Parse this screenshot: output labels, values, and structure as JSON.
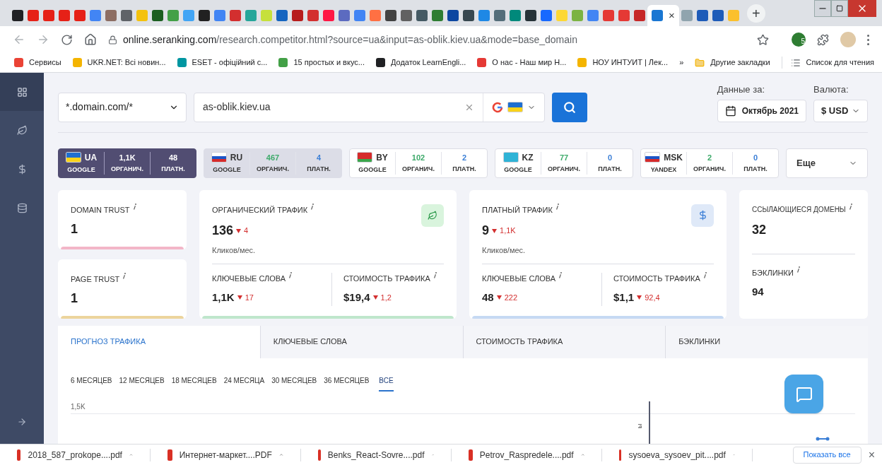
{
  "browser": {
    "tabs": [
      {
        "color": "#202124",
        "selected": false
      },
      {
        "color": "#e62117",
        "selected": false
      },
      {
        "color": "#e62117",
        "selected": false
      },
      {
        "color": "#e62117",
        "selected": false
      },
      {
        "color": "#e62117",
        "selected": false
      },
      {
        "color": "#4285f4",
        "selected": false
      },
      {
        "color": "#8d6e63",
        "selected": false
      },
      {
        "color": "#5f6368",
        "selected": false
      },
      {
        "color": "#f4c20d",
        "selected": false
      },
      {
        "color": "#1b5e20",
        "selected": false
      },
      {
        "color": "#43a047",
        "selected": false
      },
      {
        "color": "#42a5f5",
        "selected": false
      },
      {
        "color": "#212121",
        "selected": false
      },
      {
        "color": "#4285f4",
        "selected": false
      },
      {
        "color": "#d32f2f",
        "selected": false
      },
      {
        "color": "#26a69a",
        "selected": false
      },
      {
        "color": "#c6e03b",
        "selected": false
      },
      {
        "color": "#1565c0",
        "selected": false
      },
      {
        "color": "#b71c1c",
        "selected": false
      },
      {
        "color": "#d32f2f",
        "selected": false
      },
      {
        "color": "#ff1744",
        "selected": false
      },
      {
        "color": "#5c6bc0",
        "selected": false
      },
      {
        "color": "#4285f4",
        "selected": false
      },
      {
        "color": "#ff7043",
        "selected": false
      },
      {
        "color": "#424242",
        "selected": false
      },
      {
        "color": "#616161",
        "selected": false
      },
      {
        "color": "#455a64",
        "selected": false
      },
      {
        "color": "#2e7d32",
        "selected": false
      },
      {
        "color": "#0d47a1",
        "selected": false
      },
      {
        "color": "#37474f",
        "selected": false
      },
      {
        "color": "#1e88e5",
        "selected": false
      },
      {
        "color": "#546e7a",
        "selected": false
      },
      {
        "color": "#00897b",
        "selected": false
      },
      {
        "color": "#263238",
        "selected": false
      },
      {
        "color": "#1769ff",
        "selected": false
      },
      {
        "color": "#fdd835",
        "selected": false
      },
      {
        "color": "#7cb342",
        "selected": false
      },
      {
        "color": "#4285f4",
        "selected": false
      },
      {
        "color": "#e53935",
        "selected": false
      },
      {
        "color": "#e53935",
        "selected": false
      },
      {
        "color": "#c62828",
        "selected": false
      },
      {
        "color": "#1976d2",
        "selected": true
      },
      {
        "color": "#90a4ae",
        "selected": false
      },
      {
        "color": "#1e5bb8",
        "selected": false
      },
      {
        "color": "#1e5bb8",
        "selected": false
      },
      {
        "color": "#fbc02d",
        "selected": false
      }
    ],
    "tab_close": "×",
    "new_tab": "+",
    "url_host": "online.seranking.com",
    "url_path": "/research.competitor.html?source=ua&input=as-oblik.kiev.ua&mode=base_domain",
    "extension_badge": "5",
    "bookmarks": [
      {
        "label": "Сервисы",
        "color": "#ea4335"
      },
      {
        "label": "UKR.NET: Всі новин...",
        "color": "#f4b400"
      },
      {
        "label": "ESET - офіційний с...",
        "color": "#0096a1"
      },
      {
        "label": "15 простых и вкус...",
        "color": "#43a047"
      },
      {
        "label": "Додаток LearnEngli...",
        "color": "#202124"
      },
      {
        "label": "О нас - Наш мир Н...",
        "color": "#e53935"
      },
      {
        "label": "НОУ ИНТУИТ | Лек...",
        "color": "#f4b400"
      }
    ],
    "bookmarks_more": "»",
    "other_bookmarks": "Другие закладки",
    "reading_list": "Список для чтения"
  },
  "search": {
    "mode": "*.domain.com/*",
    "query": "as-oblik.kiev.ua",
    "date_label": "Данные за:",
    "date": "Октябрь 2021",
    "currency_label": "Валюта:",
    "currency": "$ USD"
  },
  "regions": [
    {
      "kind": "ua",
      "code": "UA",
      "engine": "GOOGLE",
      "organic": "1,1K",
      "organic_label": "ОРГАНИЧ.",
      "paid": "48",
      "paid_label": "ПЛАТН.",
      "selected": true,
      "hovered": false
    },
    {
      "kind": "ru",
      "code": "RU",
      "engine": "GOOGLE",
      "organic": "467",
      "organic_label": "ОРГАНИЧ.",
      "paid": "4",
      "paid_label": "ПЛАТН.",
      "selected": false,
      "hovered": true
    },
    {
      "kind": "by",
      "code": "BY",
      "engine": "GOOGLE",
      "organic": "102",
      "organic_label": "ОРГАНИЧ.",
      "paid": "2",
      "paid_label": "ПЛАТН.",
      "selected": false,
      "hovered": false
    },
    {
      "kind": "kz",
      "code": "KZ",
      "engine": "GOOGLE",
      "organic": "77",
      "organic_label": "ОРГАНИЧ.",
      "paid": "0",
      "paid_label": "ПЛАТН.",
      "selected": false,
      "hovered": false
    },
    {
      "kind": "ru",
      "code": "MSK",
      "engine": "YANDEX",
      "organic": "2",
      "organic_label": "ОРГАНИЧ.",
      "paid": "0",
      "paid_label": "ПЛАТН.",
      "selected": false,
      "hovered": false
    }
  ],
  "regions_more": "Еще",
  "trust": [
    {
      "label": "DOMAIN TRUST",
      "value": "1",
      "color": "#f3b6c8"
    },
    {
      "label": "PAGE TRUST",
      "value": "1",
      "color": "#ecd49c"
    }
  ],
  "traffic_cards": [
    {
      "kind": "organic",
      "title": "ОРГАНИЧЕСКИЙ ТРАФИК",
      "value": "136",
      "delta": "4",
      "unit": "Кликов/мес.",
      "keywords_label": "КЛЮЧЕВЫЕ СЛОВА",
      "keywords": "1,1K",
      "keywords_delta": "17",
      "cost_label": "СТОИМОСТЬ ТРАФИКА",
      "cost": "$19,4",
      "cost_delta": "1,2",
      "color": "#bfe6cc"
    },
    {
      "kind": "paid",
      "title": "ПЛАТНЫЙ ТРАФИК",
      "value": "9",
      "delta": "1,1K",
      "unit": "Кликов/мес.",
      "keywords_label": "КЛЮЧЕВЫЕ СЛОВА",
      "keywords": "48",
      "keywords_delta": "222",
      "cost_label": "СТОИМОСТЬ ТРАФИКА",
      "cost": "$1,1",
      "cost_delta": "92,4",
      "color": "#c6d9f3"
    }
  ],
  "links": {
    "domains_label": "ССЫЛАЮЩИЕСЯ ДОМЕНЫ",
    "domains": "32",
    "backlinks_label": "БЭКЛИНКИ",
    "backlinks": "94"
  },
  "chart_tabs": [
    {
      "label": "ПРОГНОЗ ТРАФИКА",
      "selected": true
    },
    {
      "label": "КЛЮЧЕВЫЕ СЛОВА",
      "selected": false
    },
    {
      "label": "СТОИМОСТЬ ТРАФИКА",
      "selected": false
    },
    {
      "label": "БЭКЛИНКИ",
      "selected": false
    }
  ],
  "periods": [
    {
      "label": "6 МЕСЯЦЕВ",
      "selected": false
    },
    {
      "label": "12 МЕСЯЦЕВ",
      "selected": false
    },
    {
      "label": "18 МЕСЯЦЕВ",
      "selected": false
    },
    {
      "label": "24 МЕСЯЦА",
      "selected": false
    },
    {
      "label": "30 МЕСЯЦЕВ",
      "selected": false
    },
    {
      "label": "36 МЕСЯЦЕВ",
      "selected": false
    },
    {
      "label": "ВСЕ",
      "selected": true
    }
  ],
  "chart": {
    "ytick": "1,5K",
    "marker_label": "ы"
  },
  "downloads": {
    "files": [
      "2018_587_prokope....pdf",
      "Интернет-маркет....PDF",
      "Benks_React-Sovre....pdf",
      "Petrov_Raspredele....pdf",
      "sysoeva_sysoev_pit....pdf"
    ],
    "show_all": "Показать все",
    "close": "×"
  }
}
